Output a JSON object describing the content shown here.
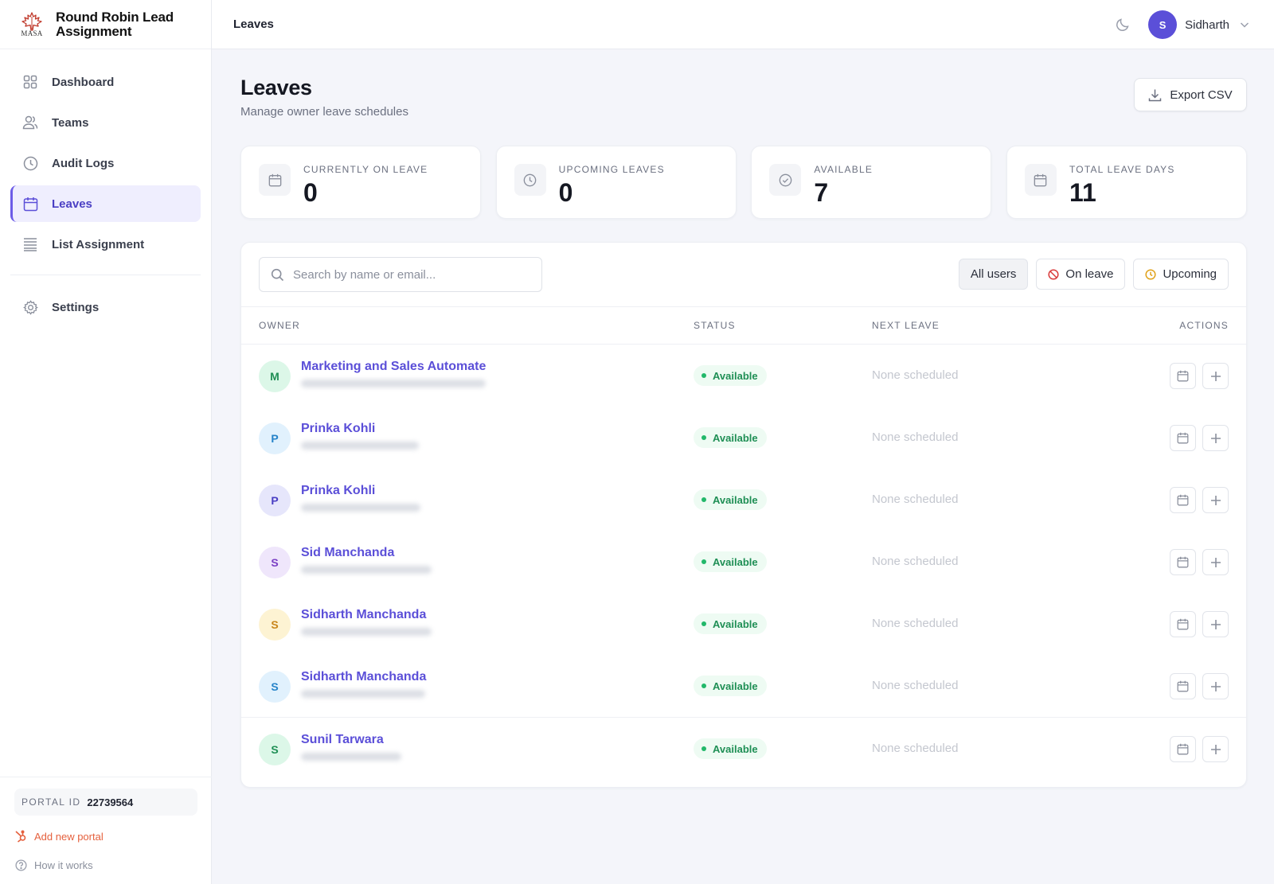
{
  "brand": {
    "title": "Round Robin Lead Assignment",
    "logo_text": "MASA"
  },
  "sidebar": {
    "items": [
      {
        "label": "Dashboard",
        "icon": "grid-icon"
      },
      {
        "label": "Teams",
        "icon": "users-icon"
      },
      {
        "label": "Audit Logs",
        "icon": "clock-icon"
      },
      {
        "label": "Leaves",
        "icon": "calendar-icon",
        "active": true
      },
      {
        "label": "List Assignment",
        "icon": "list-icon"
      }
    ],
    "settings_label": "Settings",
    "portal_label": "PORTAL ID",
    "portal_id": "22739564",
    "add_portal_label": "Add new portal",
    "how_label": "How it works"
  },
  "header": {
    "title": "Leaves",
    "user_initial": "S",
    "user_name": "Sidharth"
  },
  "page": {
    "title": "Leaves",
    "subtitle": "Manage owner leave schedules",
    "export_label": "Export CSV"
  },
  "stats": [
    {
      "label": "CURRENTLY ON LEAVE",
      "value": "0",
      "icon": "calendar-icon"
    },
    {
      "label": "UPCOMING LEAVES",
      "value": "0",
      "icon": "clock-icon"
    },
    {
      "label": "AVAILABLE",
      "value": "7",
      "icon": "check-circle-icon"
    },
    {
      "label": "TOTAL LEAVE DAYS",
      "value": "11",
      "icon": "calendar-icon"
    }
  ],
  "search": {
    "placeholder": "Search by name or email..."
  },
  "filters": {
    "all": "All users",
    "on_leave": "On leave",
    "upcoming": "Upcoming"
  },
  "table": {
    "columns": {
      "owner": "OWNER",
      "status": "STATUS",
      "next_leave": "NEXT LEAVE",
      "actions": "ACTIONS"
    },
    "rows": [
      {
        "initial": "M",
        "name": "Marketing and Sales Automate",
        "status": "Available",
        "next_leave": "None scheduled",
        "avatar_bg": "#dcf7e8",
        "avatar_fg": "#1f8f55"
      },
      {
        "initial": "P",
        "name": "Prinka Kohli",
        "status": "Available",
        "next_leave": "None scheduled",
        "avatar_bg": "#e1f1fd",
        "avatar_fg": "#2683c9"
      },
      {
        "initial": "P",
        "name": "Prinka Kohli",
        "status": "Available",
        "next_leave": "None scheduled",
        "avatar_bg": "#e6e6fb",
        "avatar_fg": "#4a3fc4"
      },
      {
        "initial": "S",
        "name": "Sid Manchanda",
        "status": "Available",
        "next_leave": "None scheduled",
        "avatar_bg": "#efe6fb",
        "avatar_fg": "#7a3fc4"
      },
      {
        "initial": "S",
        "name": "Sidharth Manchanda",
        "status": "Available",
        "next_leave": "None scheduled",
        "avatar_bg": "#fdf3d3",
        "avatar_fg": "#c9861b"
      },
      {
        "initial": "S",
        "name": "Sidharth Manchanda",
        "status": "Available",
        "next_leave": "None scheduled",
        "avatar_bg": "#e1f1fd",
        "avatar_fg": "#2683c9"
      },
      {
        "initial": "S",
        "name": "Sunil Tarwara",
        "status": "Available",
        "next_leave": "None scheduled",
        "avatar_bg": "#dcf7e8",
        "avatar_fg": "#1f8f55"
      }
    ]
  },
  "colors": {
    "accent": "#5b4fd8",
    "available": "#1f8f55",
    "danger": "#d93a3a",
    "warning": "#e0a21a",
    "hubspot": "#e5603d"
  }
}
